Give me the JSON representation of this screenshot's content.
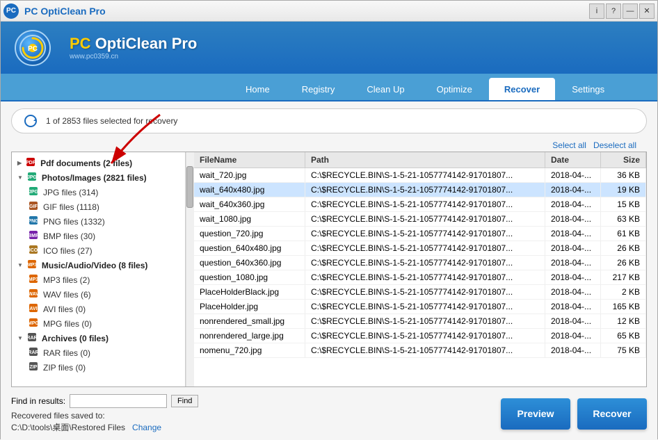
{
  "titleBar": {
    "title": "PC OptiClean Pro",
    "controls": [
      "i",
      "?",
      "—",
      "✕"
    ]
  },
  "header": {
    "appName": "PC OptiClean Pro",
    "website": "www.pc0359.cn"
  },
  "nav": {
    "tabs": [
      {
        "id": "home",
        "label": "Home"
      },
      {
        "id": "registry",
        "label": "Registry"
      },
      {
        "id": "cleanup",
        "label": "Clean Up"
      },
      {
        "id": "optimize",
        "label": "Optimize"
      },
      {
        "id": "recover",
        "label": "Recover"
      },
      {
        "id": "settings",
        "label": "Settings"
      }
    ],
    "activeTab": "recover"
  },
  "statusBar": {
    "text": "1 of 2853 files selected for recovery"
  },
  "treePanel": {
    "items": [
      {
        "id": "pdf",
        "label": "Pdf documents (2 files)",
        "level": 0,
        "expand": false,
        "iconClass": "icon-pdf"
      },
      {
        "id": "photos",
        "label": "Photos/Images (2821 files)",
        "level": 0,
        "expand": true,
        "iconClass": "icon-jpg"
      },
      {
        "id": "jpg",
        "label": "JPG files (314)",
        "level": 1,
        "iconClass": "icon-jpg"
      },
      {
        "id": "gif",
        "label": "GIF files (1118)",
        "level": 1,
        "iconClass": "icon-gif"
      },
      {
        "id": "png",
        "label": "PNG files (1332)",
        "level": 1,
        "iconClass": "icon-png"
      },
      {
        "id": "bmp",
        "label": "BMP files (30)",
        "level": 1,
        "iconClass": "icon-bmp"
      },
      {
        "id": "ico",
        "label": "ICO files (27)",
        "level": 1,
        "iconClass": "icon-ico"
      },
      {
        "id": "music",
        "label": "Music/Audio/Video (8 files)",
        "level": 0,
        "expand": true,
        "iconClass": "icon-mp3"
      },
      {
        "id": "mp3",
        "label": "MP3 files (2)",
        "level": 1,
        "iconClass": "icon-mp3"
      },
      {
        "id": "wav",
        "label": "WAV files (6)",
        "level": 1,
        "iconClass": "icon-wav"
      },
      {
        "id": "avi",
        "label": "AVI files (0)",
        "level": 1,
        "iconClass": "icon-avi"
      },
      {
        "id": "mpg",
        "label": "MPG files (0)",
        "level": 1,
        "iconClass": "icon-mpg"
      },
      {
        "id": "archives",
        "label": "Archives (0 files)",
        "level": 0,
        "expand": true,
        "iconClass": "icon-rar"
      },
      {
        "id": "rar",
        "label": "RAR files (0)",
        "level": 1,
        "iconClass": "icon-rar"
      },
      {
        "id": "zip",
        "label": "ZIP files (0)",
        "level": 1,
        "iconClass": "icon-zip"
      }
    ]
  },
  "fileList": {
    "columns": [
      "FileName",
      "Path",
      "Date",
      "Size"
    ],
    "rows": [
      {
        "name": "wait_720.jpg",
        "path": "C:\\$RECYCLE.BIN\\S-1-5-21-1057774142-91701807...",
        "date": "2018-04-...",
        "size": "36 KB",
        "selected": false
      },
      {
        "name": "wait_640x480.jpg",
        "path": "C:\\$RECYCLE.BIN\\S-1-5-21-1057774142-91701807...",
        "date": "2018-04-...",
        "size": "19 KB",
        "selected": true
      },
      {
        "name": "wait_640x360.jpg",
        "path": "C:\\$RECYCLE.BIN\\S-1-5-21-1057774142-91701807...",
        "date": "2018-04-...",
        "size": "15 KB",
        "selected": false
      },
      {
        "name": "wait_1080.jpg",
        "path": "C:\\$RECYCLE.BIN\\S-1-5-21-1057774142-91701807...",
        "date": "2018-04-...",
        "size": "63 KB",
        "selected": false
      },
      {
        "name": "question_720.jpg",
        "path": "C:\\$RECYCLE.BIN\\S-1-5-21-1057774142-91701807...",
        "date": "2018-04-...",
        "size": "61 KB",
        "selected": false
      },
      {
        "name": "question_640x480.jpg",
        "path": "C:\\$RECYCLE.BIN\\S-1-5-21-1057774142-91701807...",
        "date": "2018-04-...",
        "size": "26 KB",
        "selected": false
      },
      {
        "name": "question_640x360.jpg",
        "path": "C:\\$RECYCLE.BIN\\S-1-5-21-1057774142-91701807...",
        "date": "2018-04-...",
        "size": "26 KB",
        "selected": false
      },
      {
        "name": "question_1080.jpg",
        "path": "C:\\$RECYCLE.BIN\\S-1-5-21-1057774142-91701807...",
        "date": "2018-04-...",
        "size": "217 KB",
        "selected": false
      },
      {
        "name": "PlaceHolderBlack.jpg",
        "path": "C:\\$RECYCLE.BIN\\S-1-5-21-1057774142-91701807...",
        "date": "2018-04-...",
        "size": "2 KB",
        "selected": false
      },
      {
        "name": "PlaceHolder.jpg",
        "path": "C:\\$RECYCLE.BIN\\S-1-5-21-1057774142-91701807...",
        "date": "2018-04-...",
        "size": "165 KB",
        "selected": false
      },
      {
        "name": "nonrendered_small.jpg",
        "path": "C:\\$RECYCLE.BIN\\S-1-5-21-1057774142-91701807...",
        "date": "2018-04-...",
        "size": "12 KB",
        "selected": false
      },
      {
        "name": "nonrendered_large.jpg",
        "path": "C:\\$RECYCLE.BIN\\S-1-5-21-1057774142-91701807...",
        "date": "2018-04-...",
        "size": "65 KB",
        "selected": false
      },
      {
        "name": "nomenu_720.jpg",
        "path": "C:\\$RECYCLE.BIN\\S-1-5-21-1057774142-91701807...",
        "date": "2018-04-...",
        "size": "75 KB",
        "selected": false
      }
    ]
  },
  "bottomControls": {
    "findLabel": "Find in results:",
    "findPlaceholder": "",
    "findButtonLabel": "Find",
    "savedToLabel": "Recovered files saved to:",
    "savedToPath": "C:\\D:\\tools\\桌面\\Restored Files",
    "changeLabel": "Change",
    "selectAllLabel": "Select all",
    "deselectAllLabel": "Deselect all",
    "previewButtonLabel": "Preview",
    "recoverButtonLabel": "Recover"
  },
  "colors": {
    "primary": "#1a6bbf",
    "navBg": "#4a9fd5",
    "activeTab": "#ffffff",
    "selectedRow": "#cce4ff"
  }
}
